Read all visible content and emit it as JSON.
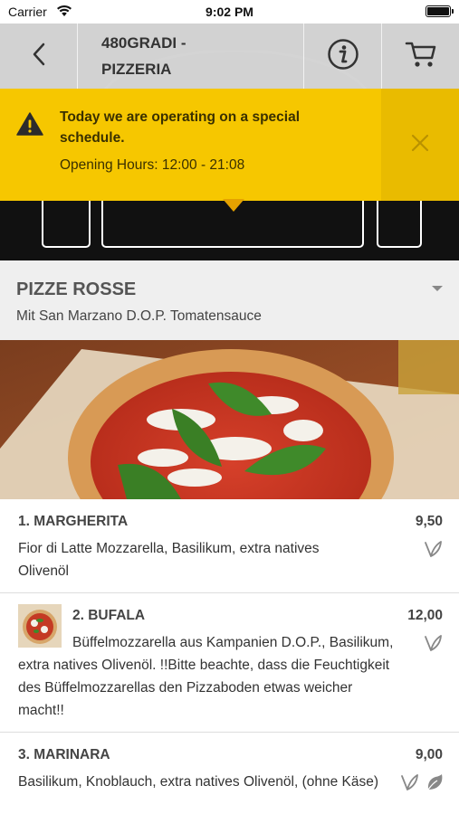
{
  "status_bar": {
    "carrier": "Carrier",
    "time": "9:02 PM"
  },
  "nav": {
    "back_icon": "chevron-left-icon",
    "title_line1": "480GRADI -",
    "title_line2": "PIZZERIA",
    "info_icon": "info-icon",
    "cart_icon": "cart-icon"
  },
  "banner": {
    "icon": "warning-icon",
    "message": "Today we are operating on a special schedule.",
    "hours": "Opening Hours: 12:00 - 21:08",
    "close_icon": "close-icon",
    "background": "#f6c700"
  },
  "category": {
    "name": "PIZZE ROSSE",
    "subtitle": "Mit San Marzano D.O.P. Tomatensauce",
    "toggle_icon": "caret-down-icon"
  },
  "items": [
    {
      "name": "1. MARGHERITA",
      "price": "9,50",
      "description": "Fior di Latte Mozzarella, Basilikum, extra natives Olivenöl",
      "icons": [
        "vegetarian-icon"
      ]
    },
    {
      "name": "2. BUFALA",
      "price": "12,00",
      "description": "Büffelmozzarella aus Kampanien D.O.P., Basilikum, extra natives Olivenöl. !!Bitte beachte, dass die Feuchtigkeit des Büffelmozzarellas den Pizzaboden etwas weicher macht!!",
      "icons": [
        "vegetarian-icon"
      ],
      "has_thumbnail": true
    },
    {
      "name": "3. MARINARA",
      "price": "9,00",
      "description": "Basilikum, Knoblauch, extra natives Olivenöl, (ohne Käse)",
      "icons": [
        "vegetarian-icon",
        "vegan-icon"
      ]
    }
  ]
}
